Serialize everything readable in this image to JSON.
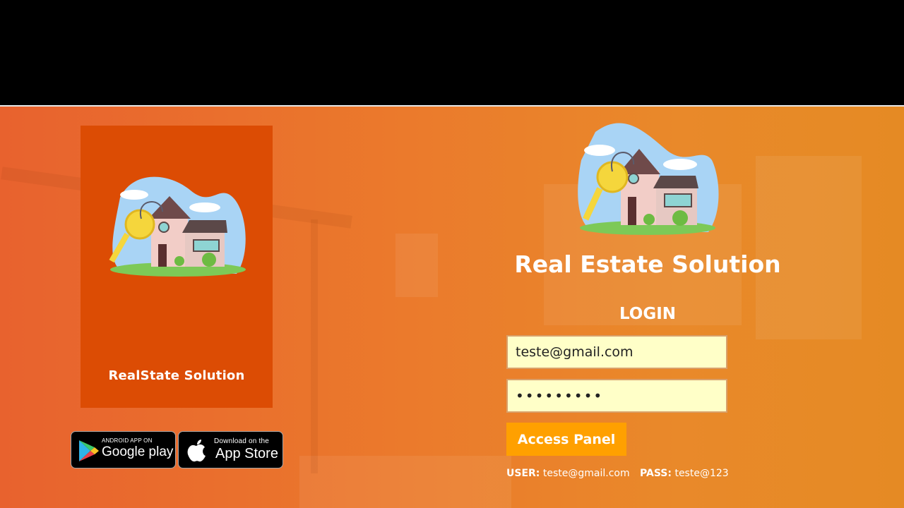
{
  "promo": {
    "title": "RealState Solution"
  },
  "stores": {
    "google": {
      "small": "ANDROID APP ON",
      "big": "Google play"
    },
    "apple": {
      "small": "Download on the",
      "big": "App Store"
    }
  },
  "login": {
    "brand_title": "Real Estate Solution",
    "heading": "LOGIN",
    "email_value": "teste@gmail.com",
    "password_value": "•••••••••",
    "submit_label": "Access Panel"
  },
  "credentials": {
    "user_label": "USER:",
    "user_value": "teste@gmail.com",
    "pass_label": "PASS:",
    "pass_value": "teste@123"
  },
  "colors": {
    "accent": "#ffa000",
    "promo_bg": "#dc4c04",
    "input_bg": "#ffffc8"
  }
}
